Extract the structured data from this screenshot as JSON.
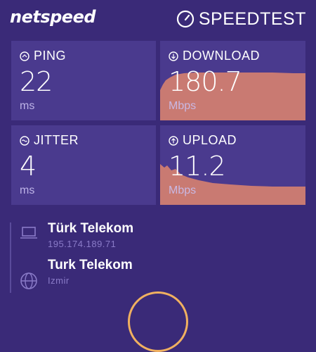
{
  "header": {
    "brand": "netspeed",
    "app_title": "SPEEDTEST"
  },
  "metrics": {
    "ping": {
      "label": "PING",
      "value": "22",
      "unit": "ms"
    },
    "download": {
      "label": "DOWNLOAD",
      "value": "180.7",
      "unit": "Mbps"
    },
    "jitter": {
      "label": "JITTER",
      "value": "4",
      "unit": "ms"
    },
    "upload": {
      "label": "UPLOAD",
      "value": "11.2",
      "unit": "Mbps"
    }
  },
  "provider": {
    "name": "Türk Telekom",
    "ip": "195.174.189.71"
  },
  "server": {
    "name": "Turk Telekom",
    "city": "Izmir"
  },
  "colors": {
    "background": "#3a2a78",
    "card": "#4a3a8e",
    "graph_fill": "#c97a72",
    "accent": "#f0b060"
  },
  "icons": [
    "speedometer-icon",
    "ping-icon",
    "download-icon",
    "jitter-icon",
    "upload-icon",
    "laptop-icon",
    "globe-icon"
  ]
}
